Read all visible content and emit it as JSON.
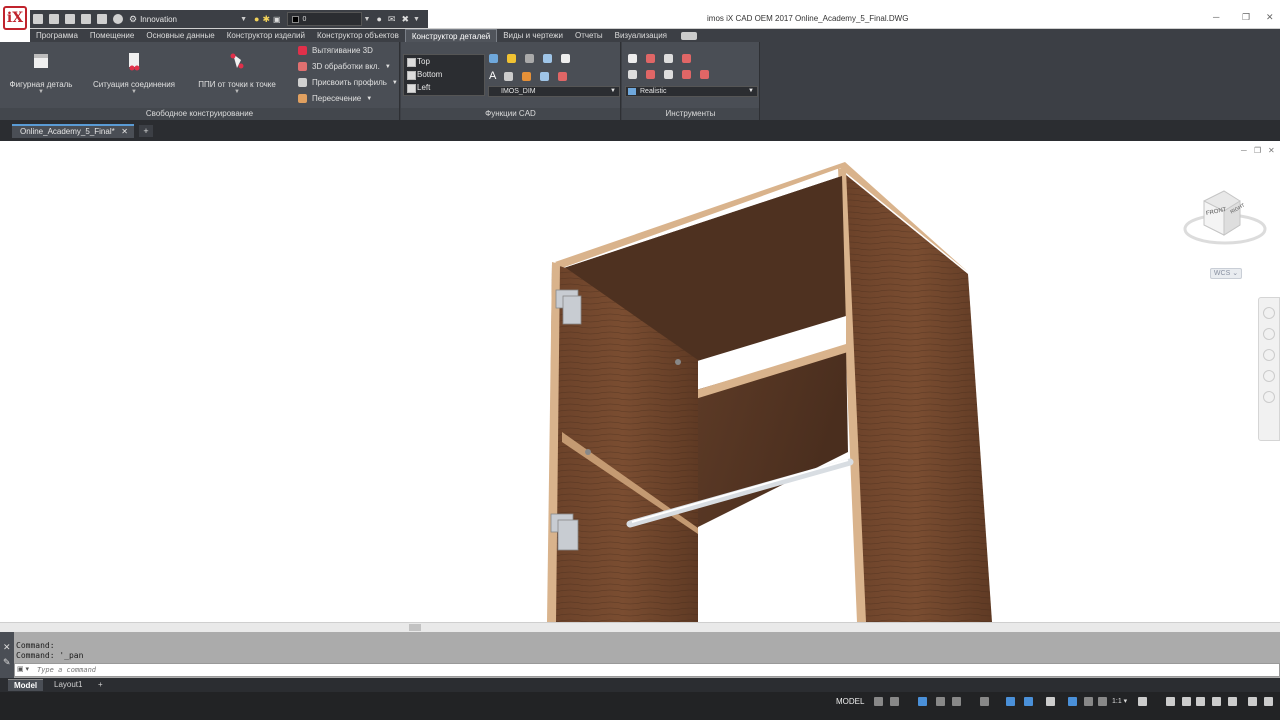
{
  "app": {
    "logo_text": "iX",
    "title": "imos iX CAD OEM 2017    Online_Academy_5_Final.DWG",
    "window_controls": [
      "─",
      "❐",
      "✕"
    ]
  },
  "quick_access": {
    "workspace": "Innovation",
    "layer": "0"
  },
  "menu": {
    "tabs": [
      "Программа",
      "Помещение",
      "Основные данные",
      "Конструктор изделий",
      "Конструктор объектов",
      "Конструктор деталей",
      "Виды и чертежи",
      "Отчеты",
      "Визуализация"
    ],
    "active_tab": "Конструктор деталей"
  },
  "ribbon": {
    "panel_free": {
      "title": "Свободное конструирование",
      "big_buttons": [
        "Фигурная деталь",
        "Ситуация соединения",
        "ППИ от точки к точке"
      ],
      "small_buttons": [
        "Вытягивание 3D",
        "3D обработки вкл.",
        "Присвоить профиль",
        "Пересечение"
      ]
    },
    "panel_cad": {
      "title": "Функции CAD",
      "views": [
        "Top",
        "Bottom",
        "Left"
      ],
      "dim_style": "IMOS_DIM"
    },
    "panel_tools": {
      "title": "Инструменты",
      "visual_style": "Realistic"
    },
    "colors": {
      "ribbon_bg": "#3c3f45",
      "panel_bg": "#4a4e55",
      "accent": "#5a9bd5"
    }
  },
  "document_tabs": {
    "tabs": [
      "Online_Academy_5_Final*"
    ],
    "new_tab_symbol": "+"
  },
  "viewport": {
    "viewcube_labels": [
      "FRONT",
      "RIGHT"
    ],
    "ucs_label": "WCS ⌄",
    "controls": [
      "─",
      "❐",
      "✕"
    ]
  },
  "command_line": {
    "history": [
      "Command:",
      "Command: '_pan"
    ],
    "placeholder": "Type a command"
  },
  "layout_tabs": {
    "tabs": [
      "Model",
      "Layout1"
    ],
    "active_tab": "Model",
    "add_symbol": "+"
  },
  "status_bar": {
    "mode": "MODEL",
    "scale": "1:1 ▾"
  }
}
